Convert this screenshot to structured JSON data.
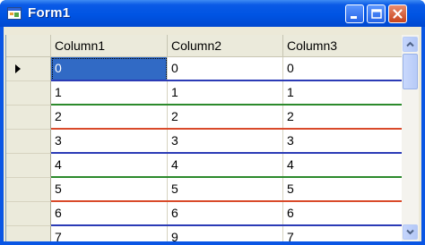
{
  "window": {
    "title": "Form1",
    "icon": "form-app-icon",
    "caption_buttons": [
      "minimize-icon",
      "maximize-icon",
      "close-icon"
    ]
  },
  "grid": {
    "columns": [
      "Column1",
      "Column2",
      "Column3"
    ],
    "selected_cell": "row 0, Column1",
    "current_row_indicator": "triangle-pointer-icon",
    "rows": [
      {
        "values": [
          "0",
          "0",
          "0"
        ],
        "line_color": "#2b3bb6"
      },
      {
        "values": [
          "1",
          "1",
          "1"
        ],
        "line_color": "#2c8a2c"
      },
      {
        "values": [
          "2",
          "2",
          "2"
        ],
        "line_color": "#d94a2a"
      },
      {
        "values": [
          "3",
          "3",
          "3"
        ],
        "line_color": "#2b3bb6"
      },
      {
        "values": [
          "4",
          "4",
          "4"
        ],
        "line_color": "#2c8a2c"
      },
      {
        "values": [
          "5",
          "5",
          "5"
        ],
        "line_color": "#d94a2a"
      },
      {
        "values": [
          "6",
          "6",
          "6"
        ],
        "line_color": "#2b3bb6"
      },
      {
        "values": [
          "7",
          "9",
          "7"
        ],
        "line_color": "#2c8a2c"
      }
    ]
  },
  "colors": {
    "titlebar": "#0054e3",
    "selection": "#316ac5",
    "header_bg": "#ebeadb"
  }
}
